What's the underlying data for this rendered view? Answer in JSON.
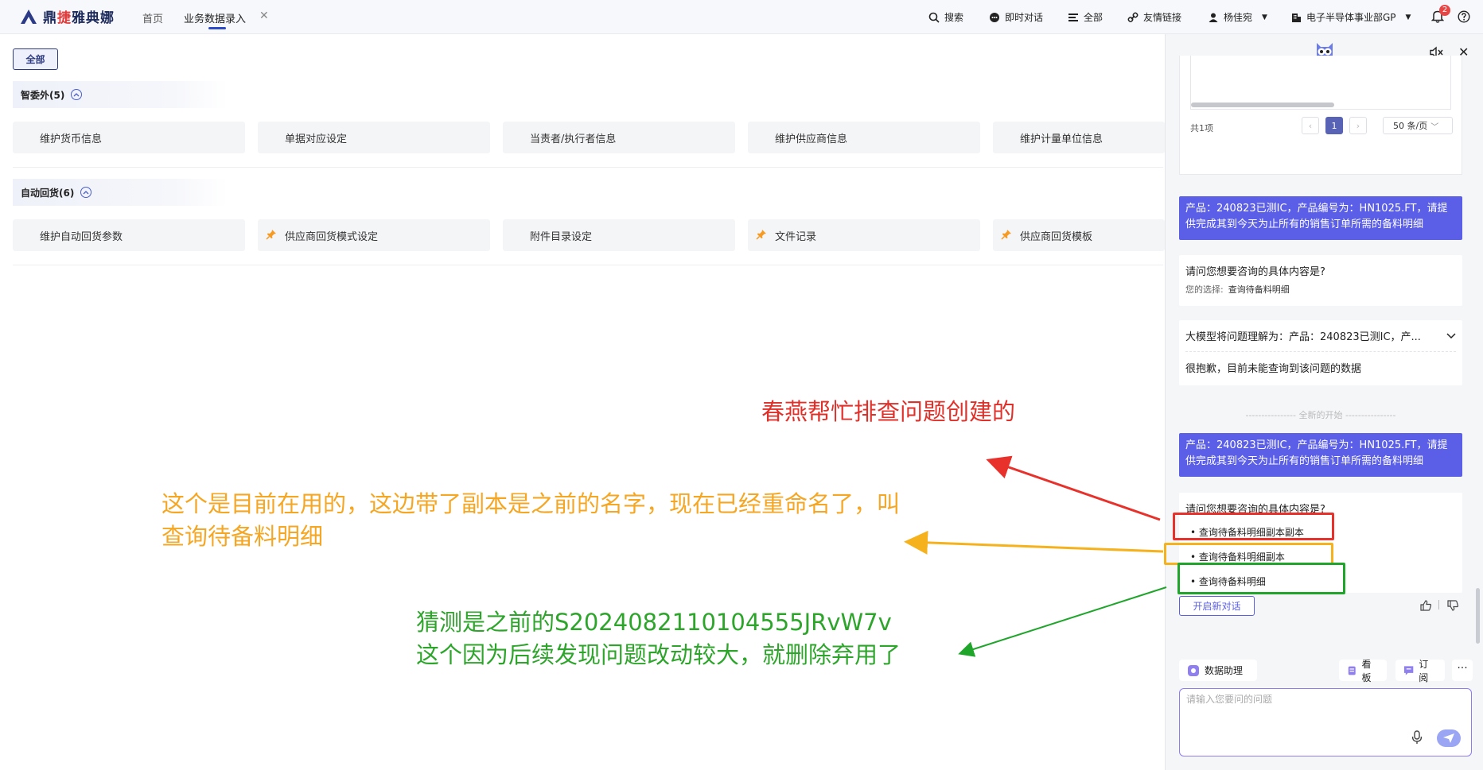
{
  "app": {
    "logo_text_1": "鼎",
    "logo_text_2": "捷",
    "logo_text_3": "雅典娜"
  },
  "nav": {
    "home": "首页",
    "tab": "业务数据录入"
  },
  "tools": {
    "search": "搜索",
    "chat": "即时对话",
    "all": "全部",
    "links": "友情链接",
    "user": "杨佳宛",
    "org": "电子半导体事业部GP",
    "notifications": "2"
  },
  "main": {
    "all_button": "全部",
    "groups": [
      {
        "title": "智委外(5)",
        "items": [
          {
            "label": "维护货币信息",
            "pinned": false
          },
          {
            "label": "单据对应设定",
            "pinned": false
          },
          {
            "label": "当责者/执行者信息",
            "pinned": false
          },
          {
            "label": "维护供应商信息",
            "pinned": false
          },
          {
            "label": "维护计量单位信息",
            "pinned": false
          }
        ]
      },
      {
        "title": "自动回货(6)",
        "items": [
          {
            "label": "维护自动回货参数",
            "pinned": false
          },
          {
            "label": "供应商回货模式设定",
            "pinned": true
          },
          {
            "label": "附件目录设定",
            "pinned": false
          },
          {
            "label": "文件记录",
            "pinned": true
          },
          {
            "label": "供应商回货模板",
            "pinned": true
          }
        ]
      }
    ]
  },
  "annotations": {
    "red": "春燕帮忙排查问题创建的",
    "yellow_line1": "这个是目前在用的，这边带了副本是之前的名字，现在已经重命名了，叫",
    "yellow_line2": "查询待备料明细",
    "green_line1": "猜测是之前的S2024082110104555JRvW7v",
    "green_line2": "这个因为后续发现问题改动较大，就删除弃用了",
    "colors": {
      "red": "#e0302a",
      "yellow": "#f5a623",
      "green": "#2ca52a"
    }
  },
  "panel": {
    "pagination": {
      "total": "共1项",
      "current": "1",
      "page_size": "50 条/页"
    },
    "messages": {
      "user_1": "产品：240823已测IC，产品编号为：HN1025.FT，请提供完成其到今天为止所有的销售订单所需的备料明细",
      "bot_1_question": "请问您想要咨询的具体内容是?",
      "bot_1_choice_label": "您的选择:",
      "bot_1_choice": "查询待备料明细",
      "bot_2_understand": "大模型将问题理解为：产品：240823已测IC，产...",
      "bot_2_sorry": "很抱歉，目前未能查询到该问题的数据",
      "new_start": "---------------- 全新的开始 ----------------",
      "user_2": "产品：240823已测IC，产品编号为：HN1025.FT，请提供完成其到今天为止所有的销售订单所需的备料明细",
      "bot_3_question": "请问您想要咨询的具体内容是?",
      "options": [
        "• 查询待备料明细副本副本",
        "• 查询待备料明细副本",
        "• 查询待备料明细"
      ]
    },
    "new_chat": "开启新对话",
    "bottom_tools": {
      "data_assistant": "数据助理",
      "board": "看板",
      "subscribe": "订阅",
      "more": "···"
    },
    "input_placeholder": "请输入您要问的问题"
  }
}
